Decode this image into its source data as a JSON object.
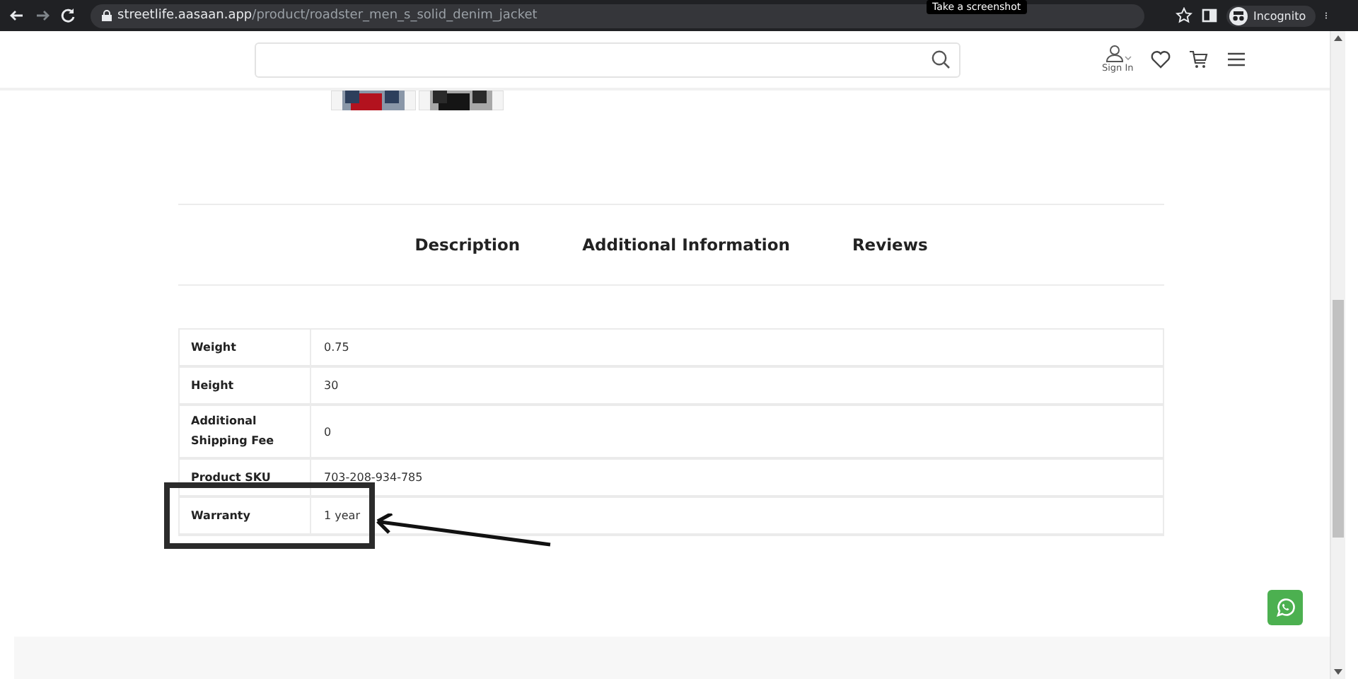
{
  "browser": {
    "url_host": "streetlife.aasaan.app",
    "url_path": "/product/roadster_men_s_solid_denim_jacket",
    "tooltip": "Take a screenshot",
    "profile": "Incognito"
  },
  "header": {
    "sign_in": "Sign In"
  },
  "tabs": [
    {
      "label": "Description"
    },
    {
      "label": "Additional Information"
    },
    {
      "label": "Reviews"
    }
  ],
  "specs": [
    {
      "label": "Weight",
      "value": "0.75",
      "highlighted": false
    },
    {
      "label": "Height",
      "value": "30",
      "highlighted": false
    },
    {
      "label": "Additional Shipping Fee",
      "value": "0",
      "highlighted": false
    },
    {
      "label": "Product SKU",
      "value": "703-208-934-785",
      "highlighted": false
    },
    {
      "label": "Warranty",
      "value": "1 year",
      "highlighted": true
    }
  ]
}
